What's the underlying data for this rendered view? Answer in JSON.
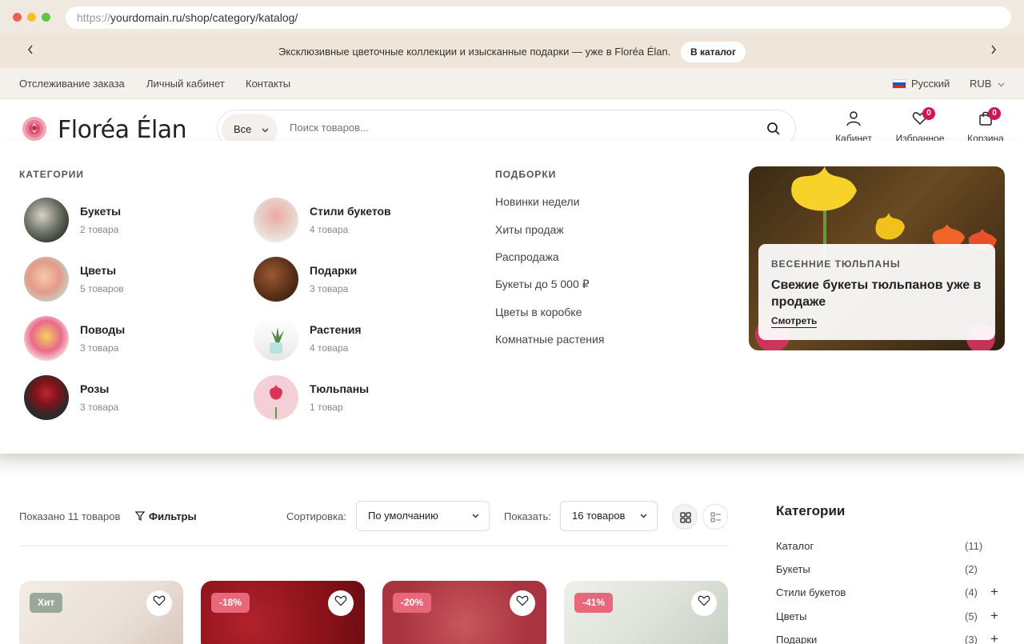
{
  "browser": {
    "url_protocol": "https://",
    "url_rest": "yourdomain.ru/shop/category/katalog/"
  },
  "promo_bar": {
    "text": "Эксклюзивные цветочные коллекции и изысканные подарки — уже в Floréa Élan.",
    "button": "В каталог",
    "prev_icon": "chevron-left-icon",
    "next_icon": "chevron-right-icon"
  },
  "topnav": {
    "links": [
      "Отслеживание заказа",
      "Личный кабинет",
      "Контакты"
    ],
    "language": "Русский",
    "currency": "RUB"
  },
  "header": {
    "logo": "Floréa Élan",
    "search": {
      "category": "Все",
      "placeholder": "Поиск товаров..."
    },
    "account_label": "Кабинет",
    "wishlist_label": "Избранное",
    "wishlist_count": "0",
    "cart_label": "Корзина",
    "cart_count": "0"
  },
  "mega_menu": {
    "categories_heading": "КАТЕГОРИИ",
    "categories": [
      {
        "name": "Букеты",
        "count": "2 товара"
      },
      {
        "name": "Стили букетов",
        "count": "4 товара"
      },
      {
        "name": "Цветы",
        "count": "5 товаров"
      },
      {
        "name": "Подарки",
        "count": "3 товара"
      },
      {
        "name": "Поводы",
        "count": "3 товара"
      },
      {
        "name": "Растения",
        "count": "4 товара"
      },
      {
        "name": "Розы",
        "count": "3 товара"
      },
      {
        "name": "Тюльпаны",
        "count": "1 товар"
      }
    ],
    "collections_heading": "ПОДБОРКИ",
    "collections": [
      "Новинки недели",
      "Хиты продаж",
      "Распродажа",
      "Букеты до 5 000 ₽",
      "Цветы в коробке",
      "Комнатные растения"
    ],
    "promo": {
      "kicker": "ВЕСЕННИЕ ТЮЛЬПАНЫ",
      "title": "Свежие букеты тюльпанов уже в продаже",
      "link": "Смотреть"
    }
  },
  "listing": {
    "shown": "Показано 11 товаров",
    "filters": "Фильтры",
    "sort_label": "Сортировка:",
    "sort_value": "По умолчанию",
    "show_label": "Показать:",
    "show_value": "16 товаров",
    "cards": [
      {
        "tag": "Хит",
        "tag_color": "#9aa99a"
      },
      {
        "tag": "-18%",
        "tag_color": "#e8677a"
      },
      {
        "tag": "-20%",
        "tag_color": "#e8677a"
      },
      {
        "tag": "-41%",
        "tag_color": "#e8677a"
      }
    ]
  },
  "sidebar": {
    "title": "Категории",
    "items": [
      {
        "name": "Каталог",
        "count": "(11)",
        "expandable": false
      },
      {
        "name": "Букеты",
        "count": "(2)",
        "expandable": false
      },
      {
        "name": "Стили букетов",
        "count": "(4)",
        "expandable": true
      },
      {
        "name": "Цветы",
        "count": "(5)",
        "expandable": true
      },
      {
        "name": "Подарки",
        "count": "(3)",
        "expandable": true
      }
    ]
  },
  "colors": {
    "accent": "#d4145a",
    "banner_bg": "#efe6d9",
    "topnav_bg": "#f4f1ed"
  }
}
